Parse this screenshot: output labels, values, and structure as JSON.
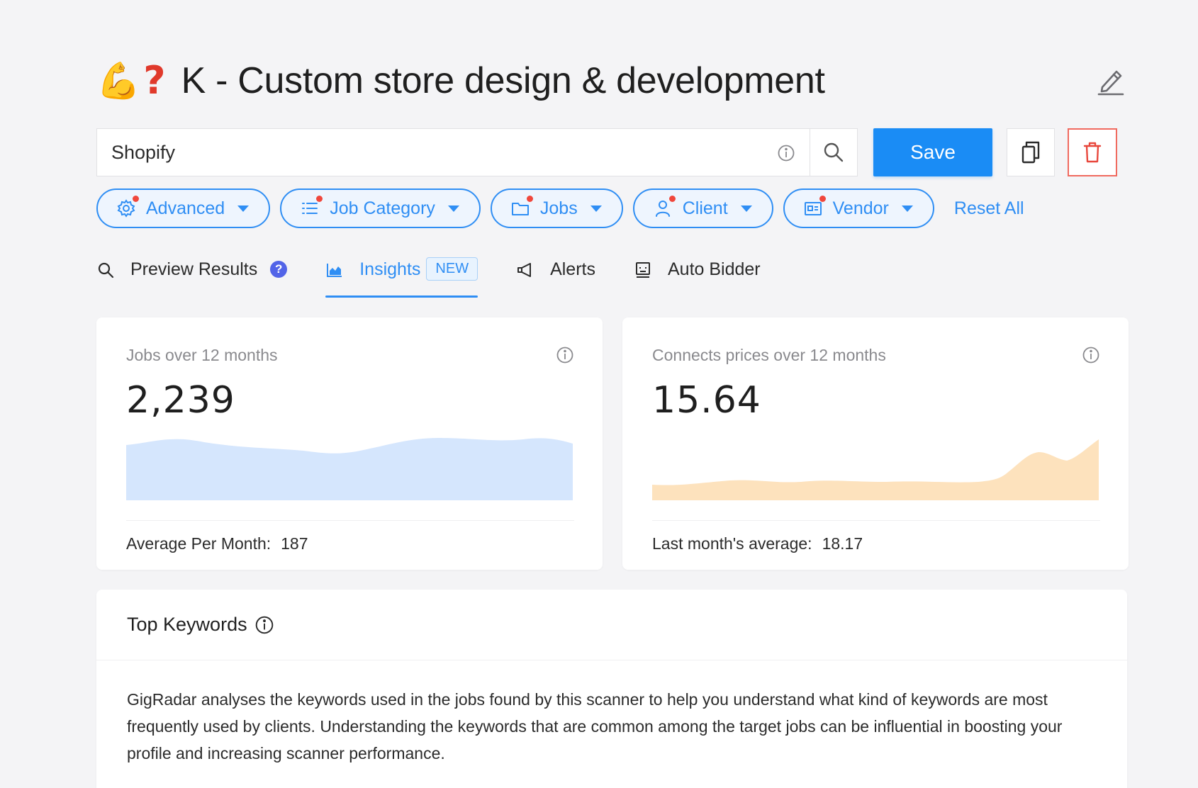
{
  "header": {
    "emoji_arm": "💪",
    "emoji_question": "?",
    "title": "K - Custom store design & development"
  },
  "search": {
    "value": "Shopify",
    "placeholder": "",
    "save_label": "Save"
  },
  "filters": [
    {
      "label": "Advanced",
      "icon": "gear-icon"
    },
    {
      "label": "Job Category",
      "icon": "list-icon"
    },
    {
      "label": "Jobs",
      "icon": "folder-icon"
    },
    {
      "label": "Client",
      "icon": "user-icon"
    },
    {
      "label": "Vendor",
      "icon": "vendor-card-icon"
    }
  ],
  "reset_all_label": "Reset All",
  "tabs": [
    {
      "label": "Preview Results",
      "icon": "search-icon",
      "badge": "?"
    },
    {
      "label": "Insights",
      "icon": "chart-icon",
      "badge": "NEW",
      "active": true
    },
    {
      "label": "Alerts",
      "icon": "megaphone-icon"
    },
    {
      "label": "Auto Bidder",
      "icon": "robot-icon"
    }
  ],
  "colors": {
    "accent": "#2f8ef4",
    "save": "#1a8cf5",
    "danger": "#f06a5f",
    "jobs_area": "#d5e6fd",
    "connects_area": "#fde2bd"
  },
  "cards": {
    "jobs": {
      "label": "Jobs over 12 months",
      "value": "2,239",
      "footer_label": "Average Per Month:",
      "footer_value": "187"
    },
    "connects": {
      "label": "Connects prices over 12 months",
      "value": "15.64",
      "footer_label": "Last month's average:",
      "footer_value": "18.17"
    }
  },
  "keywords": {
    "title": "Top Keywords",
    "body": "GigRadar analyses the keywords used in the jobs found by this scanner to help you understand what kind of keywords are most frequently used by clients. Understanding the keywords that are common among the target jobs can be influential in boosting your profile and increasing scanner performance."
  }
}
